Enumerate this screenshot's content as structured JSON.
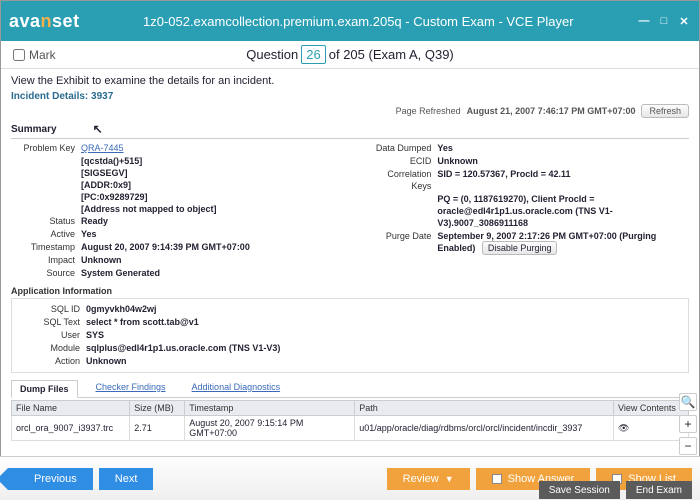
{
  "titlebar": {
    "logo_pre": "ava",
    "logo_mid": "n",
    "logo_post": "set",
    "title": "1z0-052.examcollection.premium.exam.205q - Custom Exam - VCE Player"
  },
  "header": {
    "mark": "Mark",
    "pre": "Question ",
    "num": "26",
    "post": " of 205 (Exam A, Q39)"
  },
  "body": {
    "instr": "View the Exhibit to examine the details for an incident.",
    "panel_title": "Incident Details: 3937",
    "refresh": {
      "label": "Page Refreshed",
      "ts": "August 21, 2007 7:46:17 PM GMT+07:00",
      "btn": "Refresh"
    },
    "summary": "Summary",
    "left": {
      "problem_key_k": "Problem Key",
      "problem_key_v": "QRA-7445",
      "sub": [
        "[qcstda()+515]",
        "[SIGSEGV]",
        "[ADDR:0x9]",
        "[PC:0x9289729]",
        "[Address not mapped to object]"
      ],
      "status_k": "Status",
      "status_v": "Ready",
      "active_k": "Active",
      "active_v": "Yes",
      "ts_k": "Timestamp",
      "ts_v": "August 20, 2007 9:14:39 PM GMT+07:00",
      "impact_k": "Impact",
      "impact_v": "Unknown",
      "source_k": "Source",
      "source_v": "System Generated"
    },
    "right": {
      "dd_k": "Data Dumped",
      "dd_v": "Yes",
      "ecid_k": "ECID",
      "ecid_v": "Unknown",
      "ck_k": "Correlation Keys",
      "ck_v": "SID = 120.57367, ProcId = 42.11",
      "ck_l2": "PQ = (0, 1187619270), Client ProcId = oracle@edl4r1p1.us.oracle.com (TNS V1-V3).9007_3086911168",
      "pd_k": "Purge Date",
      "pd_v": "September 9, 2007 2:17:26 PM GMT+07:00 (Purging Enabled)",
      "db": "Disable Purging"
    },
    "app": {
      "hdr": "Application Information",
      "sql_id_k": "SQL ID",
      "sql_id_v": "0gmyvkh04w2wj",
      "sql_txt_k": "SQL Text",
      "sql_txt_v": "select * from scott.tab@v1",
      "user_k": "User",
      "user_v": "SYS",
      "module_k": "Module",
      "module_v": "sqlplus@edl4r1p1.us.oracle.com (TNS V1-V3)",
      "action_k": "Action",
      "action_v": "Unknown"
    },
    "tabs": {
      "t1": "Dump Files",
      "t2": "Checker Findings",
      "t3": "Additional Diagnostics"
    },
    "table": {
      "h1": "File Name",
      "h2": "Size (MB)",
      "h3": "Timestamp",
      "h4": "Path",
      "h5": "View Contents",
      "r1c1": "orcl_ora_9007_i3937.trc",
      "r1c2": "2.71",
      "r1c3": "August 20, 2007 9:15:14 PM GMT+07:00",
      "r1c4": "u01/app/oracle/diag/rdbms/orcl/orcl/incident/incdir_3937",
      "r1c5": "eye-icon"
    }
  },
  "footer": {
    "prev": "Previous",
    "next": "Next",
    "review": "Review",
    "show_ans": "Show Answer",
    "show_list": "Show List",
    "save": "Save Session",
    "end": "End Exam"
  }
}
